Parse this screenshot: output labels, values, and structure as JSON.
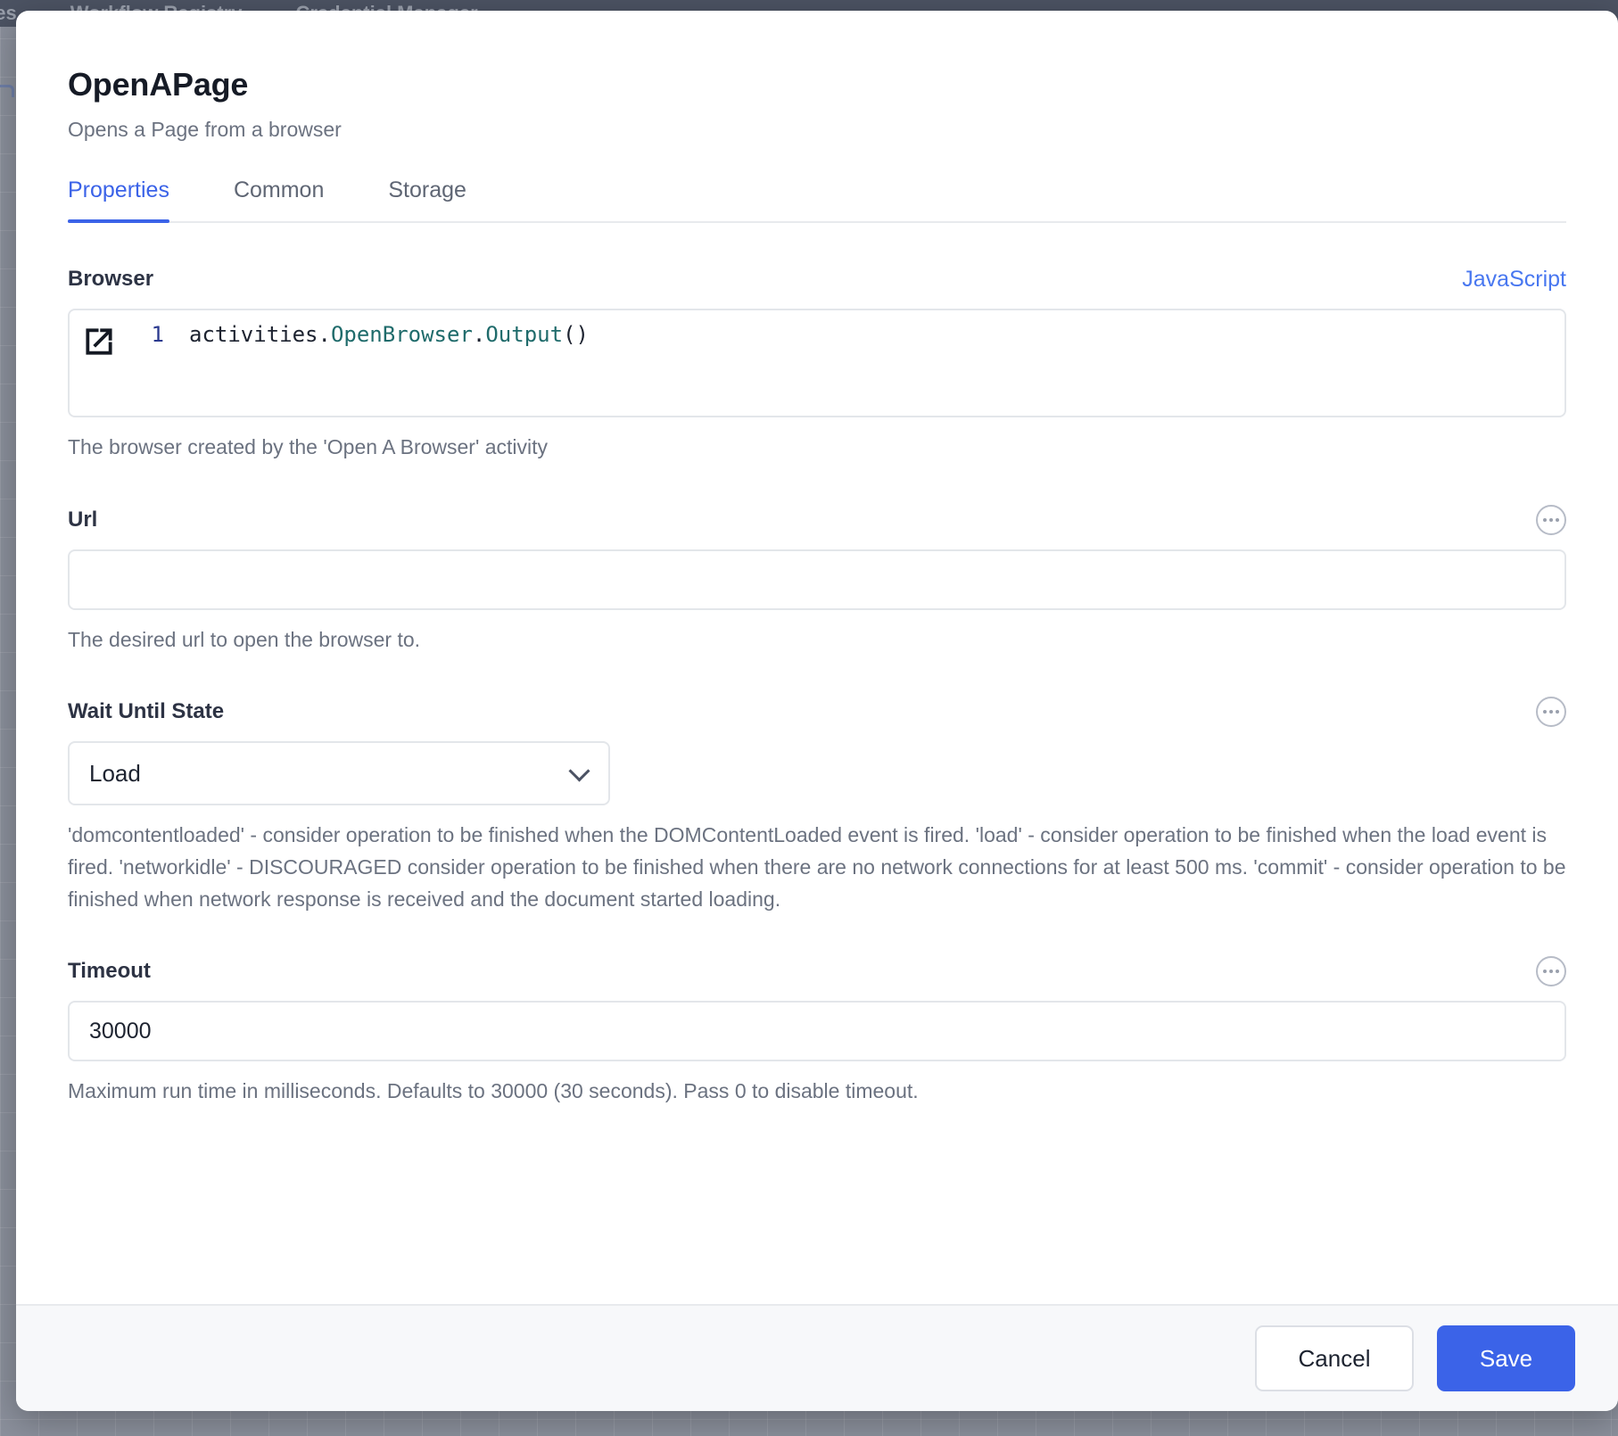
{
  "background": {
    "nav_items": [
      "ces",
      "Workflow Registry",
      "Credential Manager"
    ]
  },
  "dialog": {
    "title": "OpenAPage",
    "subtitle": "Opens a Page from a browser",
    "tabs": [
      {
        "label": "Properties",
        "active": true
      },
      {
        "label": "Common",
        "active": false
      },
      {
        "label": "Storage",
        "active": false
      }
    ],
    "fields": {
      "browser": {
        "label": "Browser",
        "language_label": "JavaScript",
        "expand_icon": "external-link-icon",
        "line_number": "1",
        "code_tokens": [
          {
            "text": "activities.",
            "type": "plain"
          },
          {
            "text": "OpenBrowser",
            "type": "ident"
          },
          {
            "text": ".",
            "type": "plain"
          },
          {
            "text": "Output",
            "type": "ident"
          },
          {
            "text": "()",
            "type": "plain"
          }
        ],
        "code_text": "activities.OpenBrowser.Output()",
        "hint": "The browser created by the 'Open A Browser' activity"
      },
      "url": {
        "label": "Url",
        "more_icon": "ellipsis-icon",
        "value": "",
        "placeholder": "",
        "hint": "The desired url to open the browser to."
      },
      "wait_until_state": {
        "label": "Wait Until State",
        "more_icon": "ellipsis-icon",
        "selected": "Load",
        "chevron_icon": "chevron-down-icon",
        "hint": "'domcontentloaded' - consider operation to be finished when the DOMContentLoaded event is fired. 'load' - consider operation to be finished when the load event is fired. 'networkidle' - DISCOURAGED consider operation to be finished when there are no network connections for at least 500 ms. 'commit' - consider operation to be finished when network response is received and the document started loading."
      },
      "timeout": {
        "label": "Timeout",
        "more_icon": "ellipsis-icon",
        "value": "30000",
        "placeholder": "",
        "hint": "Maximum run time in milliseconds. Defaults to 30000 (30 seconds). Pass 0 to disable timeout."
      }
    },
    "footer": {
      "cancel_label": "Cancel",
      "save_label": "Save"
    }
  },
  "colors": {
    "accent": "#3b63e8",
    "link": "#4877f0",
    "code_identifier": "#1f6b6b",
    "backdrop": "#8b909c",
    "topbar": "#4c5363",
    "footer_bg": "#f7f8fa"
  }
}
